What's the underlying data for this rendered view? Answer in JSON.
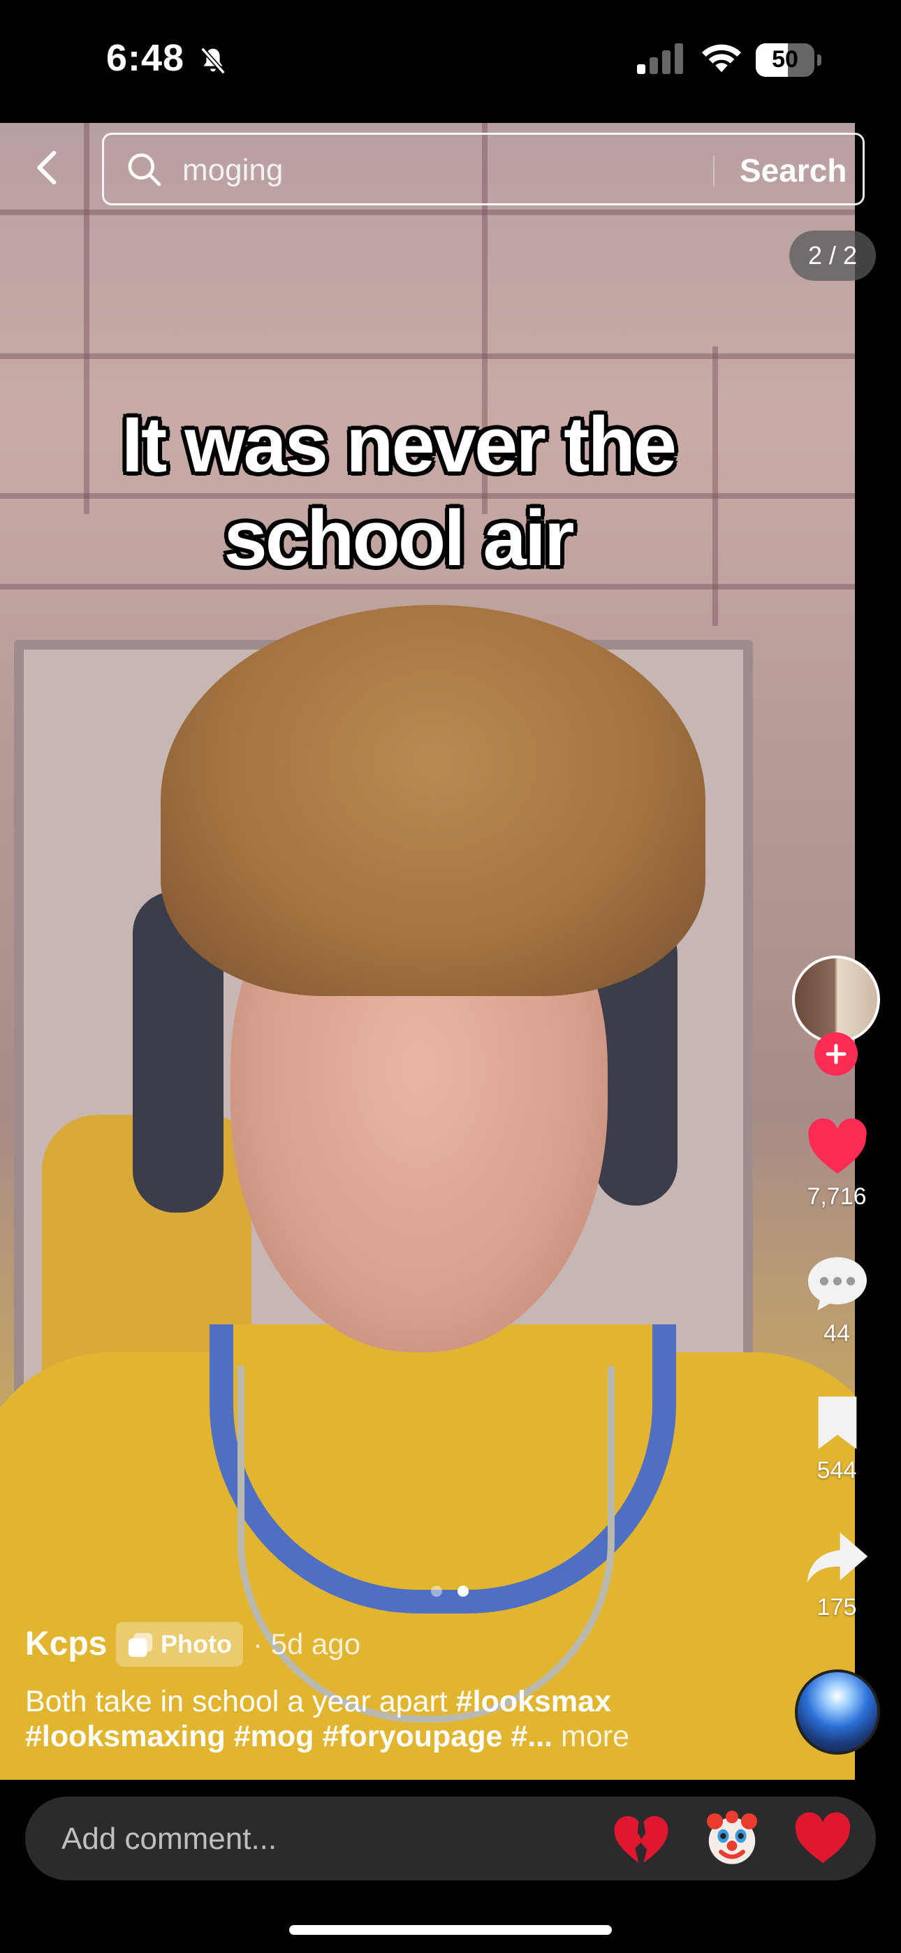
{
  "status": {
    "time": "6:48",
    "battery": "50"
  },
  "search": {
    "query": "moging",
    "button_label": "Search"
  },
  "photo_counter": "2 / 2",
  "overlay_caption": {
    "line1": "It was never the",
    "line2": "school air"
  },
  "rail": {
    "likes": "7,716",
    "comments": "44",
    "saves": "544",
    "shares": "175"
  },
  "post": {
    "username": "Kcps",
    "badge": "Photo",
    "time": "· 5d ago",
    "description_line1_plain": "Both take in school a year apart ",
    "description_line1_tag": "#looksmax",
    "description_line2": "#looksmaxing #mog #foryoupage #... ",
    "more_label": "more",
    "carousel": {
      "count": 2,
      "active_index": 2
    }
  },
  "comment": {
    "placeholder": "Add comment..."
  },
  "colors": {
    "accent": "#fe2c55",
    "like": "#fe2c55",
    "background": "#000000"
  },
  "icons": [
    "back-icon",
    "search-icon",
    "heart-icon",
    "comment-icon",
    "bookmark-icon",
    "share-icon",
    "plus-icon",
    "broken-heart-emoji",
    "clown-emoji",
    "red-heart-emoji",
    "bell-slash-icon",
    "wifi-icon",
    "cellular-icon",
    "battery-icon"
  ]
}
